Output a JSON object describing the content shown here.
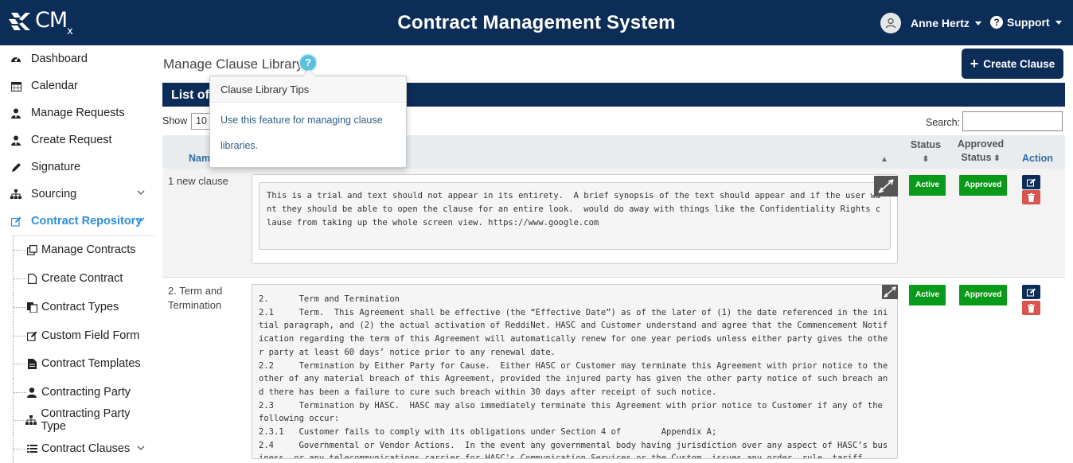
{
  "header": {
    "logo_text": "CM",
    "logo_sub": "x",
    "title": "Contract Management System",
    "user_name": "Anne Hertz",
    "support_label": "Support",
    "color_bg": "#0c2d57"
  },
  "sidebar": {
    "items": [
      {
        "label": "Dashboard",
        "icon": "dashboard-icon"
      },
      {
        "label": "Calendar",
        "icon": "calendar-icon"
      },
      {
        "label": "Manage Requests",
        "icon": "user-tie-icon"
      },
      {
        "label": "Create Request",
        "icon": "user-tie-icon"
      },
      {
        "label": "Signature",
        "icon": "pen-icon"
      },
      {
        "label": "Sourcing",
        "icon": "sitemap-icon"
      },
      {
        "label": "Contract Repository",
        "icon": "edit-icon"
      }
    ],
    "sub_items": [
      {
        "label": "Manage Contracts",
        "icon": "clone-icon"
      },
      {
        "label": "Create Contract",
        "icon": "file-icon"
      },
      {
        "label": "Contract Types",
        "icon": "files-icon"
      },
      {
        "label": "Custom Field Form",
        "icon": "edit-icon"
      },
      {
        "label": "Contract Templates",
        "icon": "file-text-icon"
      },
      {
        "label": "Contracting Party",
        "icon": "user-icon"
      },
      {
        "label": "Contracting Party Type",
        "icon": "sitemap-icon"
      },
      {
        "label": "Contract Clauses",
        "icon": "list-icon"
      }
    ]
  },
  "page": {
    "title": "Manage Clause Library",
    "help": "?",
    "create_button": "Create Clause",
    "list_header": "List of",
    "show_label": "Show",
    "show_value": "10",
    "search_label": "Search:"
  },
  "popover": {
    "title": "Clause Library Tips",
    "body": "Use this feature for managing clause libraries."
  },
  "table": {
    "columns": {
      "name": "Name",
      "status": "Status",
      "approved_status": "Approved Status",
      "action": "Action"
    },
    "rows": [
      {
        "name": "1 new clause",
        "text": "This is a trial and text should not appear in its entirety.  A brief synopsis of the text should appear and if the user want they should be able to open the clause for an entire look.  would do away with things like the Confidentiality Rights clause from taking up the whole screen view. https://www.google.com",
        "status": "Active",
        "approved": "Approved"
      },
      {
        "name": "2. Term and Termination",
        "text": "2.      Term and Termination\n2.1     Term.  This Agreement shall be effective (the “Effective Date”) as of the later of (1) the date referenced in the initial paragraph, and (2) the actual activation of ReddiNet. HASC and Customer understand and agree that the Commencement Notification regarding the term of this Agreement will automatically renew for one year periods unless either party gives the other party at least 60 days’ notice prior to any renewal date.\n2.2     Termination by Either Party for Cause.  Either HASC or Customer may terminate this Agreement with prior notice to the other of any material breach of this Agreement, provided the injured party has given the other party notice of such breach and there has been a failure to cure such breach within 30 days after receipt of such notice.\n2.3     Termination by HASC.  HASC may also immediately terminate this Agreement with prior notice to Customer if any of the following occur:\n2.3.1   Customer fails to comply with its obligations under Section 4 of        Appendix A;\n2.4     Governmental or Vendor Actions.  In the event any governmental body having jurisdiction over any aspect of HASC’s business, or any telecommunications carrier for HASC's Communication Services or the Custom, issues any order, rule, tariff",
        "status": "Active",
        "approved": "Approved"
      }
    ]
  }
}
